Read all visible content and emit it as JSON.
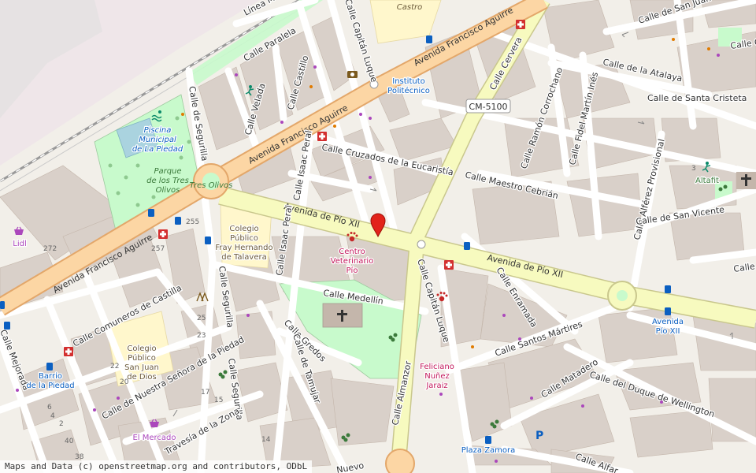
{
  "map": {
    "streets": {
      "linea": "Línea M",
      "calle_paralela": "Calle Paralela",
      "calle_castillo": "Calle Castillo",
      "calle_velada": "Calle Velada",
      "calle_segurilla_n": "Calle de Segurilla",
      "av_fa_top": "Avenida Francisco Aguirre",
      "av_fa_mid": "Avenida Francisco Aguirre",
      "av_fa_low": "Avenida Francisco Aguirre",
      "capitan_luque_n": "Calle Capitán Luque",
      "calle_cervera": "Calle Cervera",
      "calle_san_juan": "Calle de San Juan",
      "calle_atalaya": "Calle de la Atalaya",
      "calle_santa_cristeta": "Calle de Santa Cristeta",
      "calle_ramon": "Calle Ramón Corrochano",
      "calle_fidel": "Calle Fidel Martín Inés",
      "calle_cruzados": "Calle Cruzados de la Eucaristía",
      "calle_isaac_n": "Calle Isaac Peral",
      "calle_maestro": "Calle Maestro Cebrián",
      "calle_alferez": "Calle Alférez Provisional",
      "calle_san_vicente": "Calle de San Vicente",
      "av_pio_w": "Avenida de Pío XII",
      "av_pio_e": "Avenida de Pío XII",
      "calle_isaac_s": "Calle Isaac Peral",
      "capitan_luque_s": "Calle Capitán Luque",
      "calle_enramada": "Calle Enramada",
      "calle_medellin": "Calle Medellín",
      "calle_segurilla_s": "Calle Segurilla",
      "calle_segurilla_ss": "Calle Segurilla",
      "calle_comuneros": "Calle Comuneros de Castilla",
      "calle_gredos": "Calle Gredos",
      "calle_tamujar": "Calle de Tamujar",
      "calle_almanzor": "Calle Almanzor",
      "calle_santos": "Calle Santos Mártires",
      "calle_matadero": "Calle Matadero",
      "calle_duque": "Calle del Duque de Wellington",
      "calle_nuestra": "Calle de Nuestra Señora de la Piedad",
      "travesia_zona": "Travesía de la Zona",
      "calle_mejorada": "Calle Mejorada",
      "calle_nuevo": "Nuevo",
      "calle_alfar": "Calle Alfar",
      "calle_ca": "Calle Ca",
      "calle_right": "Calle",
      "cm5100": "CM-5100"
    },
    "pois": {
      "castro": "Castro",
      "instituto_1": "Instituto",
      "instituto_2": "Politécnico",
      "piscina_1": "Piscina",
      "piscina_2": "Municipal",
      "piscina_3": "de La Piedad",
      "parque_1": "Parque",
      "parque_2": "de los Tres",
      "parque_3": "Olivos",
      "tres_olivos": "Tres Olivos",
      "colegio_fray_1": "Colegio",
      "colegio_fray_2": "Público",
      "colegio_fray_3": "Fray Hernando",
      "colegio_fray_4": "de Talavera",
      "centro_vet_1": "Centro",
      "centro_vet_2": "Veterinario",
      "centro_vet_3": "Pío",
      "colegio_sj_1": "Colegio",
      "colegio_sj_2": "Público",
      "colegio_sj_3": "San Juan",
      "colegio_sj_4": "de Dios",
      "barrio_1": "Barrio",
      "barrio_2": "de la Piedad",
      "lidl": "Lidl",
      "el_mercado": "El Mercado",
      "feliciano_1": "Feliciano",
      "feliciano_2": "Nuñez",
      "feliciano_3": "Jaraiz",
      "av_pio_stop_1": "Avenida",
      "av_pio_stop_2": "Pío XII",
      "plaza_zamora": "Plaza Zamora",
      "altafit": "Altafit"
    },
    "house_numbers": [
      "272",
      "255",
      "257",
      "25",
      "23",
      "22",
      "20",
      "17",
      "15",
      "14",
      "6",
      "4",
      "2",
      "40",
      "38",
      "3"
    ],
    "icons": [
      "red-map-marker-icon",
      "pharmacy-cross-icon",
      "bus-stop-icon",
      "church-cross-icon",
      "shopping-basket-icon",
      "veterinary-paw-icon",
      "swimming-icon",
      "fitness-icon",
      "parking-icon",
      "playground-icon",
      "camera-shop-icon",
      "peak-icon"
    ],
    "colors": {
      "background": "#f2efe9",
      "building": "#d9d0c9",
      "primary_road": "#fcd6a4",
      "primary_casing": "#e3a76a",
      "secondary_road": "#f7fabf",
      "secondary_casing": "#c9c78d",
      "park": "#c8facc",
      "school": "#fff7cc",
      "water": "#aad3df",
      "marker": "#e2231a"
    }
  },
  "attribution": "Maps and Data (c) openstreetmap.org and contributors, ODbL"
}
